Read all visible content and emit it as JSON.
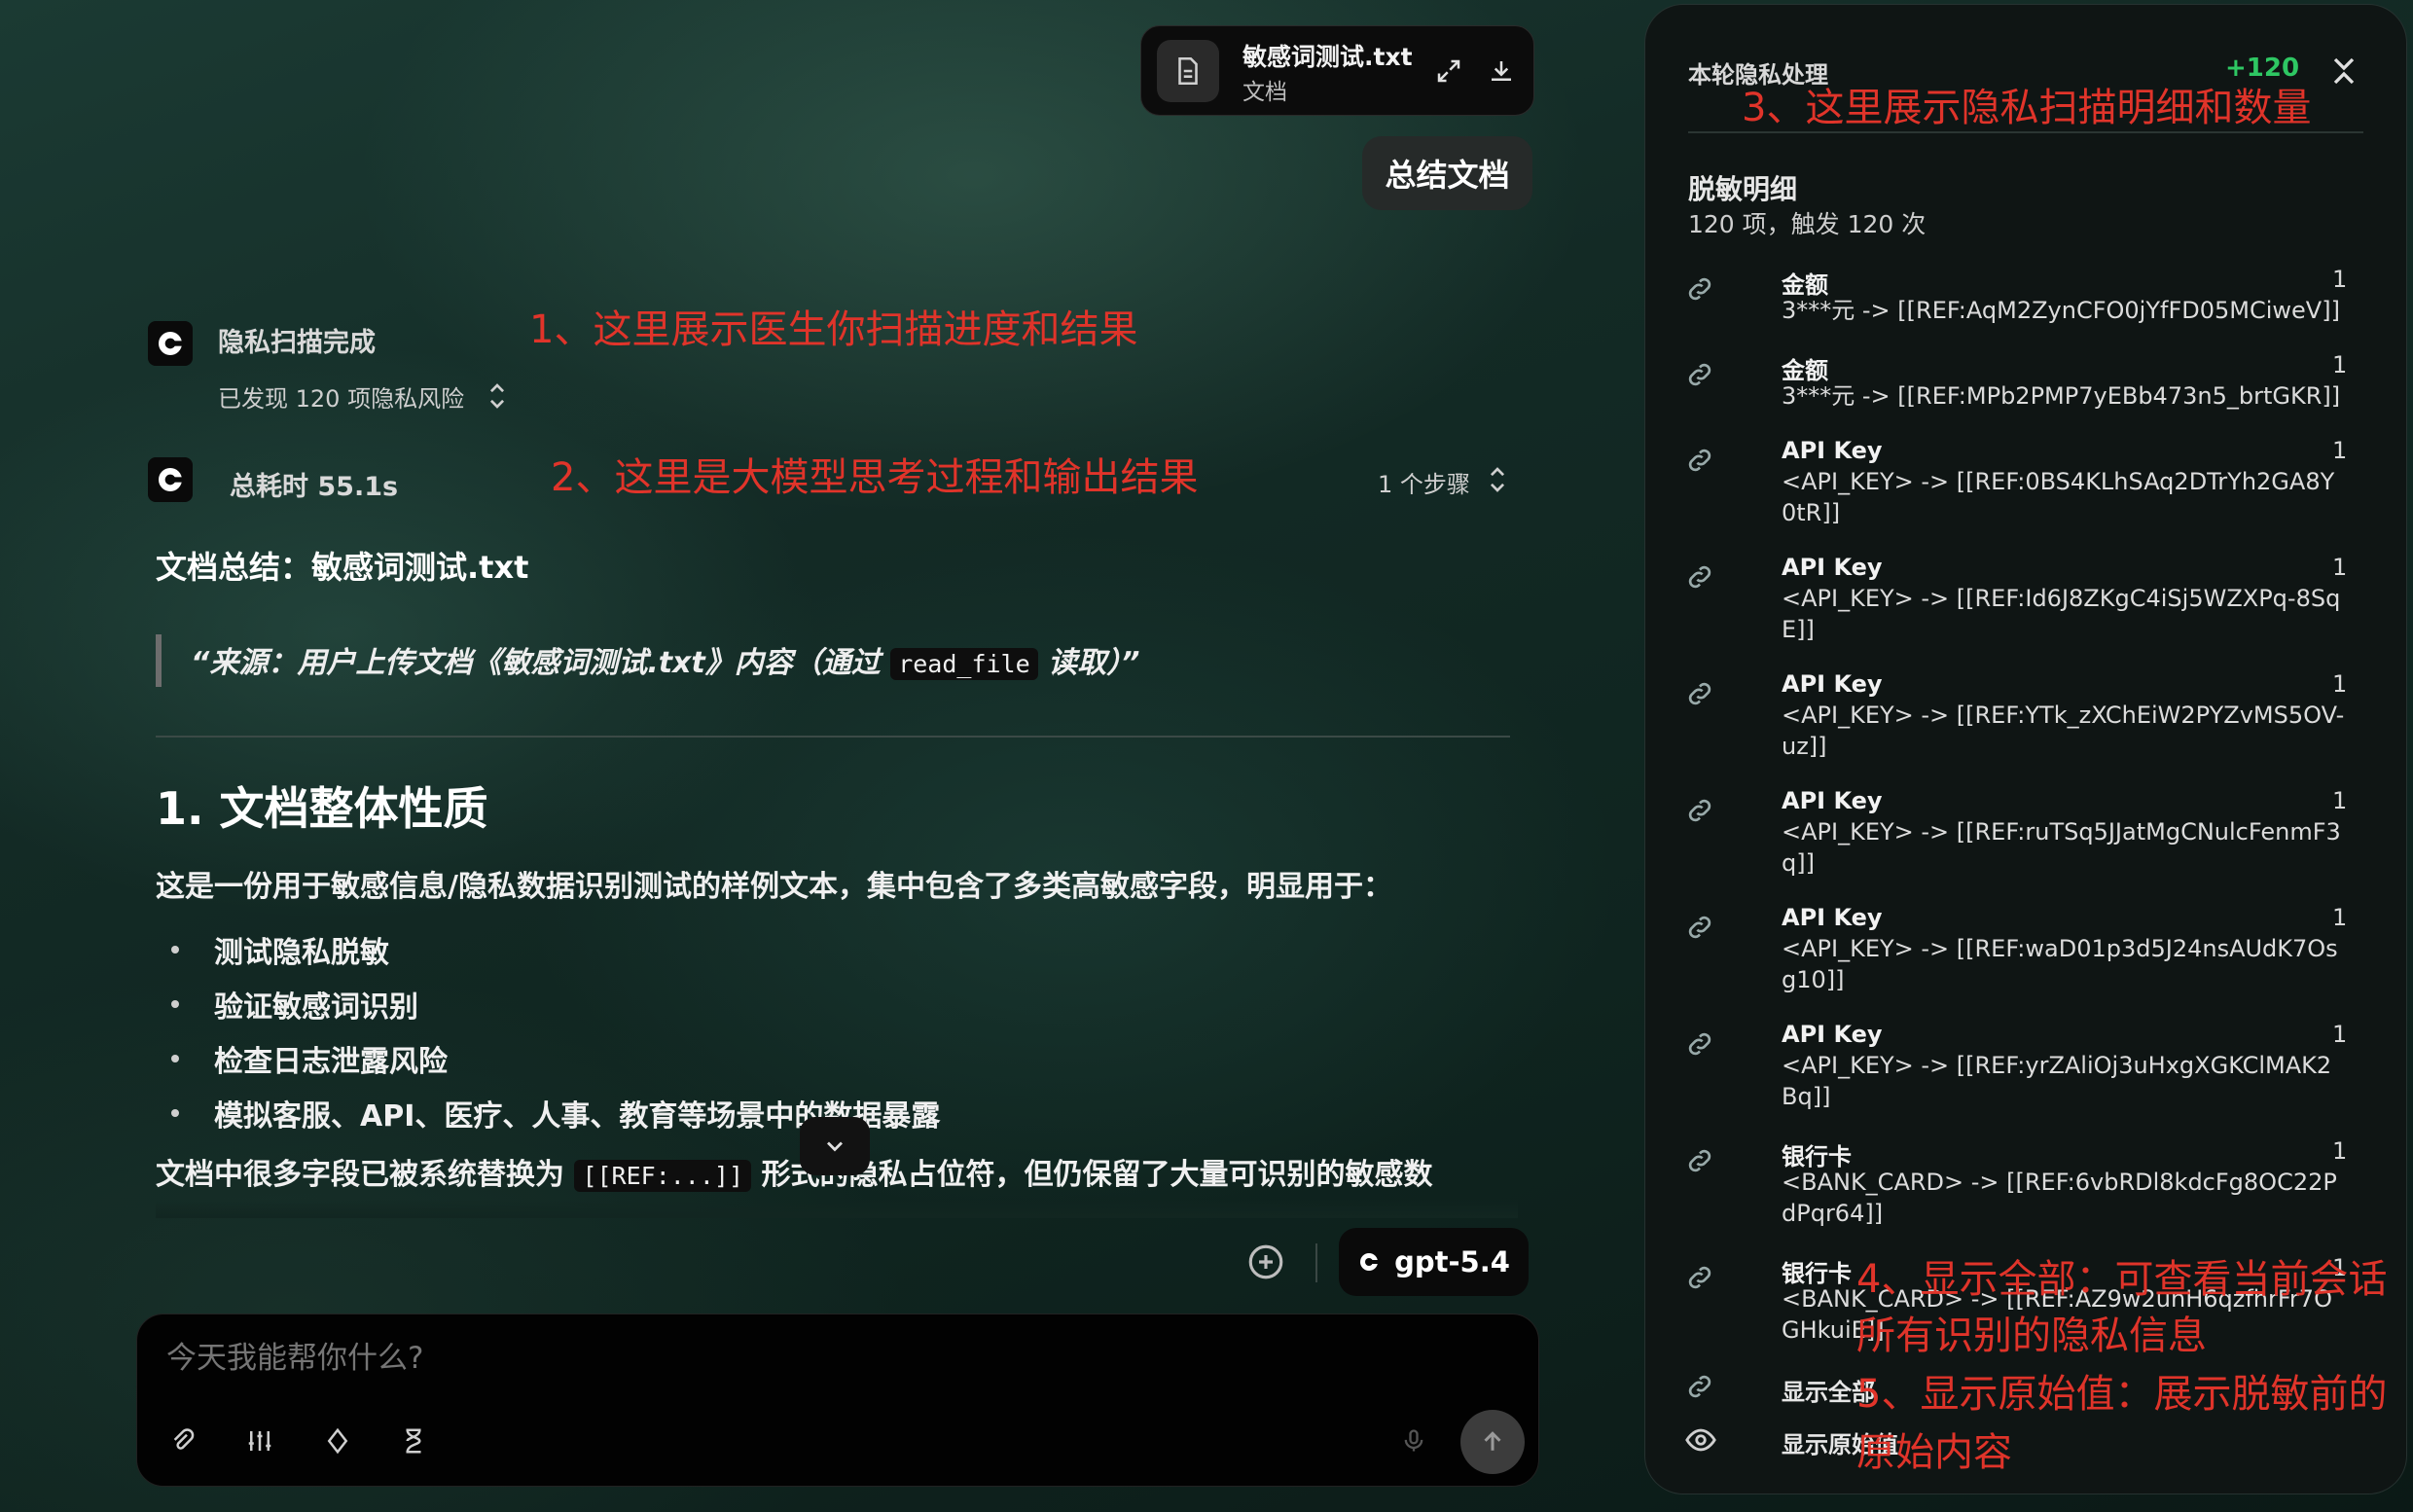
{
  "file": {
    "name": "敏感词测试.txt",
    "type": "文档",
    "icon": "document-icon"
  },
  "user_message": "总结文档",
  "scan": {
    "title": "隐私扫描完成",
    "subtitle": "已发现 120 项隐私风险"
  },
  "thinking": {
    "title": "总耗时 55.1s",
    "steps": "1 个步骤"
  },
  "content": {
    "summary_title": "文档总结：敏感词测试.txt",
    "quote_pre": "“来源：用户上传文档《敏感词测试.txt》内容（通过 ",
    "quote_code": "read_file",
    "quote_post": " 读取）”",
    "section_title": "1. 文档整体性质",
    "intro": "这是一份用于敏感信息/隐私数据识别测试的样例文本，集中包含了多类高敏感字段，明显用于：",
    "bullets": [
      "测试隐私脱敏",
      "验证敏感词识别",
      "检查日志泄露风险",
      "模拟客服、API、医疗、人事、教育等场景中的数据暴露"
    ],
    "para2_pre": "文档中很多字段已被系统替换为 ",
    "para2_code": "[[REF:...]]",
    "para2_post": " 形式的隐私占位符，但仍保留了大量可识别的敏感数"
  },
  "model": {
    "name": "gpt-5.4"
  },
  "composer": {
    "placeholder": "今天我能帮你什么?"
  },
  "panel": {
    "title": "本轮隐私处理",
    "count": "+120",
    "detail_title": "脱敏明细",
    "detail_sub": "120 项，触发 120 次",
    "items": [
      {
        "label": "金额",
        "value": "3***元 -> [[REF:AqM2ZynCFO0jYfFD05MCiweV]]",
        "count": "1"
      },
      {
        "label": "金额",
        "value": "3***元 -> [[REF:MPb2PMP7yEBb473n5_brtGKR]]",
        "count": "1"
      },
      {
        "label": "API Key",
        "value": "<API_KEY> -> [[REF:0BS4KLhSAq2DTrYh2GA8Y0tR]]",
        "count": "1"
      },
      {
        "label": "API Key",
        "value": "<API_KEY> -> [[REF:Id6J8ZKgC4iSj5WZXPq-8SqE]]",
        "count": "1"
      },
      {
        "label": "API Key",
        "value": "<API_KEY> -> [[REF:YTk_zXChEiW2PYZvMS5OV-uz]]",
        "count": "1"
      },
      {
        "label": "API Key",
        "value": "<API_KEY> -> [[REF:ruTSq5JJatMgCNulcFenmF3q]]",
        "count": "1"
      },
      {
        "label": "API Key",
        "value": "<API_KEY> -> [[REF:waD01p3d5J24nsAUdK7Osg10]]",
        "count": "1"
      },
      {
        "label": "API Key",
        "value": "<API_KEY> -> [[REF:yrZAliOj3uHxgXGKClMAK2Bq]]",
        "count": "1"
      },
      {
        "label": "银行卡",
        "value": "<BANK_CARD> -> [[REF:6vbRDl8kdcFg8OC22PdPqr64]]",
        "count": "1"
      },
      {
        "label": "银行卡",
        "value": "<BANK_CARD> -> [[REF:AZ9w2unH6qzfhrFr7OGHkuiE]]",
        "count": "1"
      }
    ],
    "show_all": "显示全部",
    "show_raw": "显示原始值"
  },
  "annotations": {
    "a1": "1、这里展示医生你扫描进度和结果",
    "a2": "2、这里是大模型思考过程和输出结果",
    "a3": "3、这里展示隐私扫描明细和数量",
    "a4_line1": "4、显示全部：可查看当前会话",
    "a4_line2": "所有识别的隐私信息",
    "a5_line1": "5、显示原始值：展示脱敏前的",
    "a5_line2": "原始内容"
  },
  "colors": {
    "accent_green": "#2ec763",
    "annotation_red": "#e0342a"
  }
}
